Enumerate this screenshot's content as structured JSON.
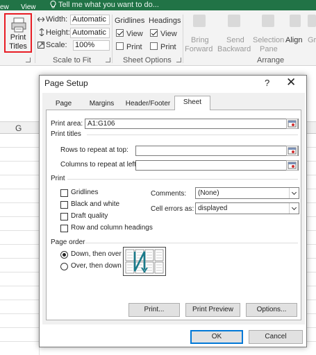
{
  "ribbon_tabs": {
    "view": "View",
    "partial": "ew"
  },
  "tell_me": "Tell me what you want to do...",
  "print_titles": {
    "line1": "Print",
    "line2": "Titles"
  },
  "scale_to_fit": {
    "width_label": "Width:",
    "width_value": "Automatic",
    "height_label": "Height:",
    "height_value": "Automatic",
    "scale_label": "Scale:",
    "scale_value": "100%",
    "group_label": "Scale to Fit"
  },
  "sheet_options": {
    "gridlines": "Gridlines",
    "headings": "Headings",
    "view": "View",
    "print": "Print",
    "gridlines_view": true,
    "gridlines_print": false,
    "headings_view": true,
    "headings_print": false,
    "group_label": "Sheet Options"
  },
  "arrange": {
    "bring_forward": [
      "Bring",
      "Forward"
    ],
    "send_backward": [
      "Send",
      "Backward"
    ],
    "selection_pane": [
      "Selection",
      "Pane"
    ],
    "align": "Align",
    "group_partial": "Gr",
    "group_label": "Arrange"
  },
  "grid": {
    "column": "G"
  },
  "dialog": {
    "title": "Page Setup",
    "help": "?",
    "close": "✕",
    "tabs": [
      "Page",
      "Margins",
      "Header/Footer",
      "Sheet"
    ],
    "active_tab": "Sheet",
    "print_area_label": "Print area:",
    "print_area_value": "A1:G106",
    "print_titles_section": "Print titles",
    "rows_repeat_label": "Rows to repeat at top:",
    "rows_repeat_value": "",
    "cols_repeat_label": "Columns to repeat at left:",
    "cols_repeat_value": "",
    "print_section": "Print",
    "gridlines": "Gridlines",
    "black_white": "Black and white",
    "draft_quality": "Draft quality",
    "row_col_headings": "Row and column headings",
    "comments_label": "Comments:",
    "comments_value": "(None)",
    "cell_errors_label": "Cell errors as:",
    "cell_errors_value": "displayed",
    "page_order_section": "Page order",
    "down_then_over": "Down, then over",
    "over_then_down": "Over, then down",
    "down_then_over_selected": true,
    "print_button": "Print...",
    "print_preview_button": "Print Preview",
    "options_button": "Options...",
    "ok_button": "OK",
    "cancel_button": "Cancel"
  },
  "colors": {
    "excel_green": "#217346",
    "highlight_red": "#e81c24",
    "focus_blue": "#0078d7"
  }
}
